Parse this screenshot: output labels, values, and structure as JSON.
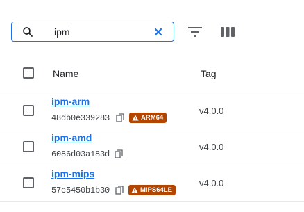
{
  "search": {
    "value": "ipm",
    "icon": "search-icon"
  },
  "toolbar": {
    "filter_icon": "filter-icon",
    "columns_icon": "columns-icon"
  },
  "table": {
    "columns": [
      "Name",
      "Tag"
    ],
    "rows": [
      {
        "name": "ipm-arm",
        "digest": "48db0e339283",
        "badge": "ARM64",
        "tag": "v4.0.0"
      },
      {
        "name": "ipm-amd",
        "digest": "6086d03a183d",
        "badge": "",
        "tag": "v4.0.0"
      },
      {
        "name": "ipm-mips",
        "digest": "57c5450b1b30",
        "badge": "MIPS64LE",
        "tag": "v4.0.0"
      }
    ]
  },
  "colors": {
    "accent": "#1a73e8",
    "warning_badge": "#b24500"
  }
}
